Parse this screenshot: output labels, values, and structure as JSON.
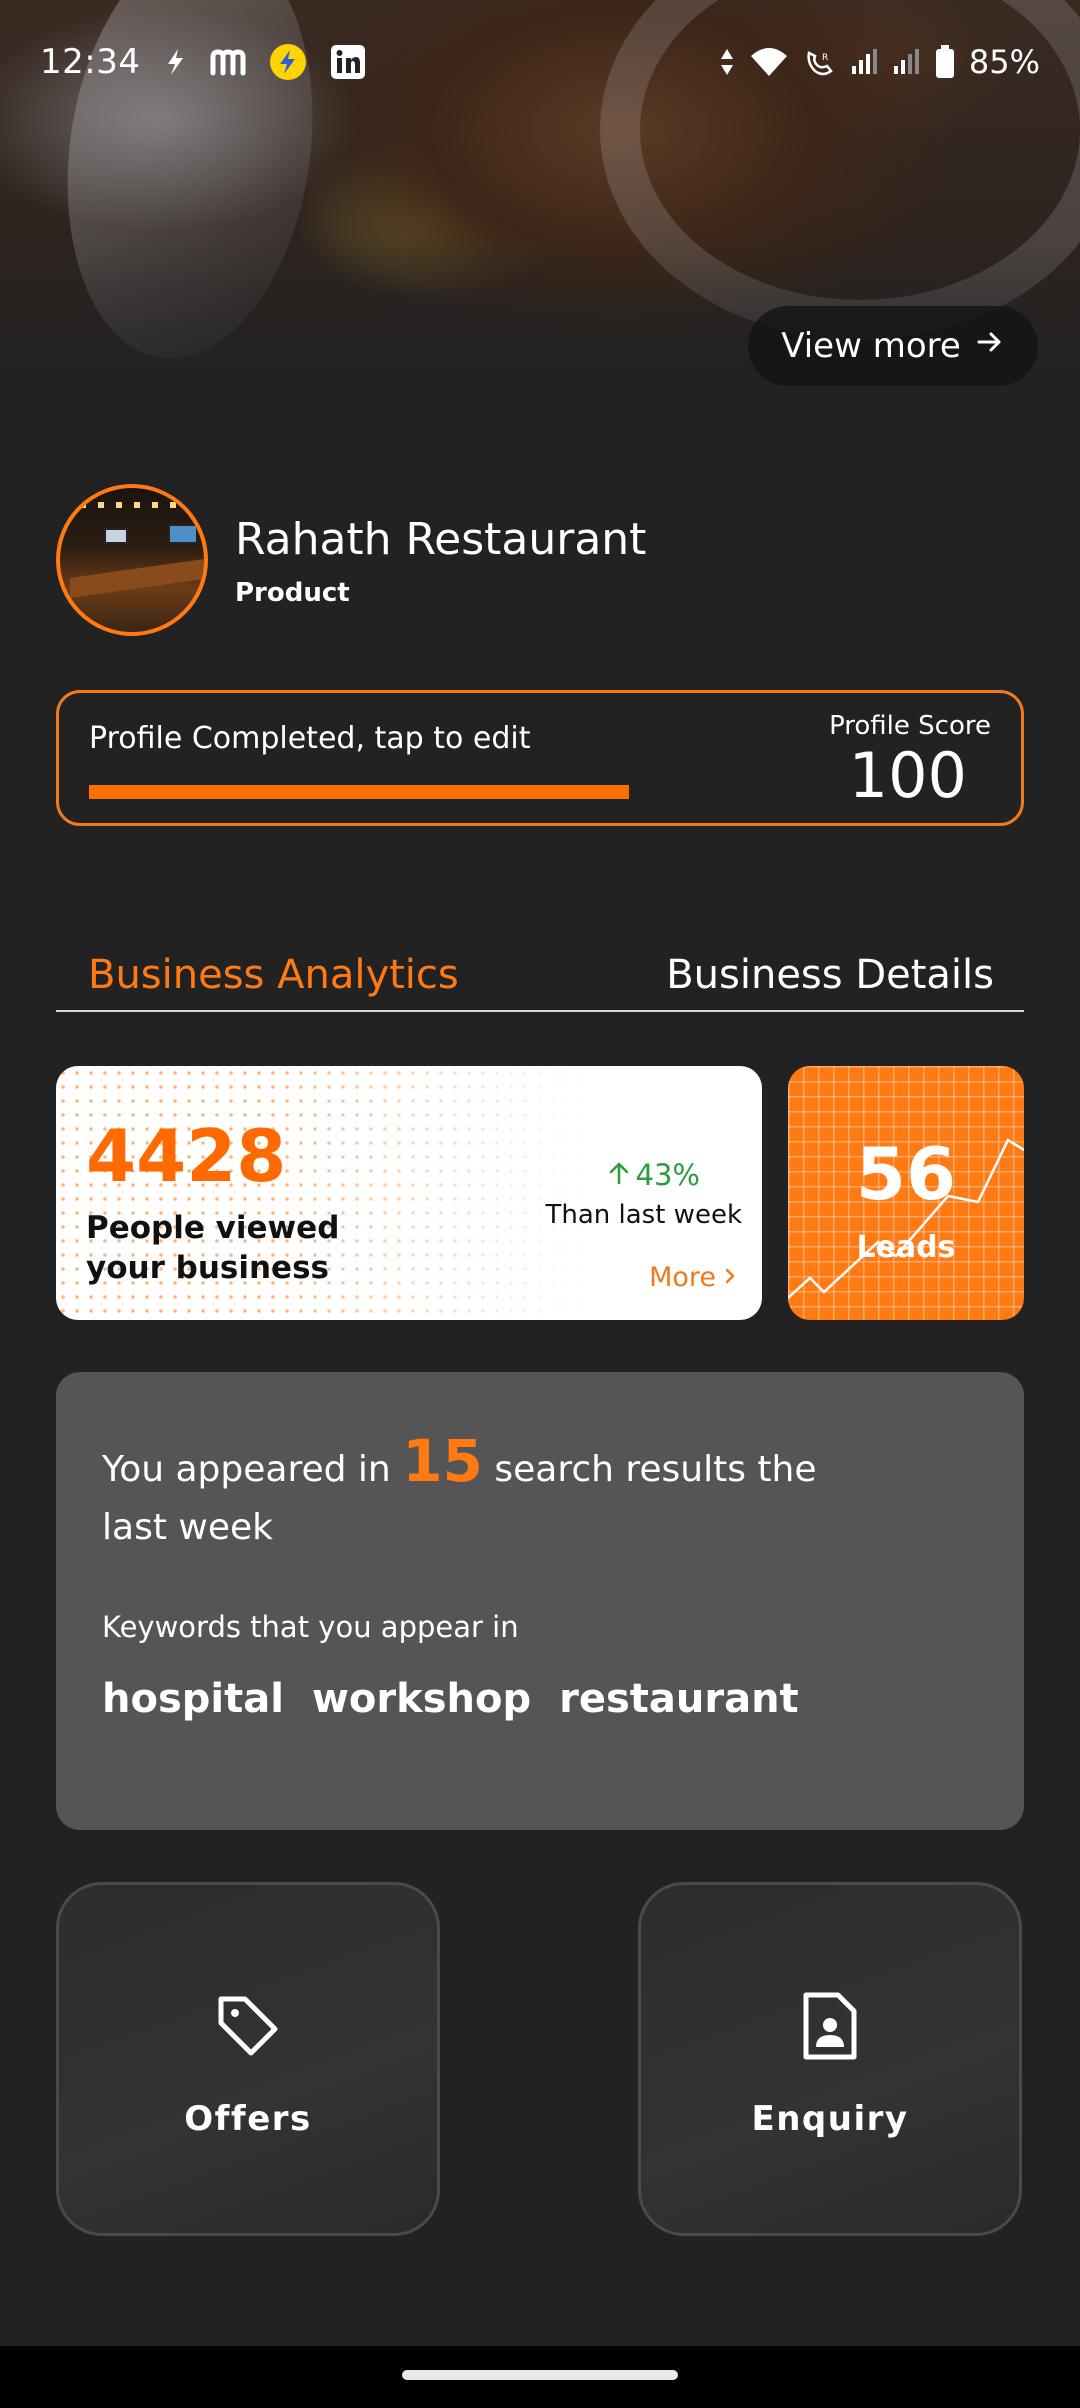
{
  "status_bar": {
    "time": "12:34",
    "battery": "85%",
    "left_icons": [
      "flash-icon",
      "meesho-icon",
      "flipkart-icon",
      "linkedin-icon"
    ],
    "right_icons": [
      "data-arrows-icon",
      "wifi-icon",
      "volte-icon",
      "signal-icon",
      "signal-icon-2",
      "battery-icon"
    ]
  },
  "hero": {
    "view_more_label": "View more",
    "arrow_icon": "arrow-right-icon"
  },
  "profile": {
    "name": "Rahath Restaurant",
    "type": "Product",
    "completion_label": "Profile Completed, tap to edit",
    "score_label": "Profile Score",
    "score": "100",
    "completion_fraction": 1.0
  },
  "tabs": [
    {
      "label": "Business Analytics",
      "active": true
    },
    {
      "label": "Business Details",
      "active": false
    }
  ],
  "analytics": {
    "views": "4428",
    "views_label": "People viewed your business",
    "change": "43%",
    "change_label": "Than last week",
    "more_label": "More",
    "leads": "56",
    "leads_label": "Leads"
  },
  "search": {
    "prefix": "You appeared in ",
    "count": "15",
    "suffix": " search results the last week",
    "keywords_label": "Keywords that you appear in",
    "keywords": [
      "hospital",
      "workshop",
      "restaurant"
    ]
  },
  "actions": {
    "offers_label": "Offers",
    "enquiry_label": "Enquiry"
  },
  "colors": {
    "accent": "#ff7a12",
    "background": "#222222",
    "card": "#555555",
    "positive": "#2e9b3e"
  }
}
